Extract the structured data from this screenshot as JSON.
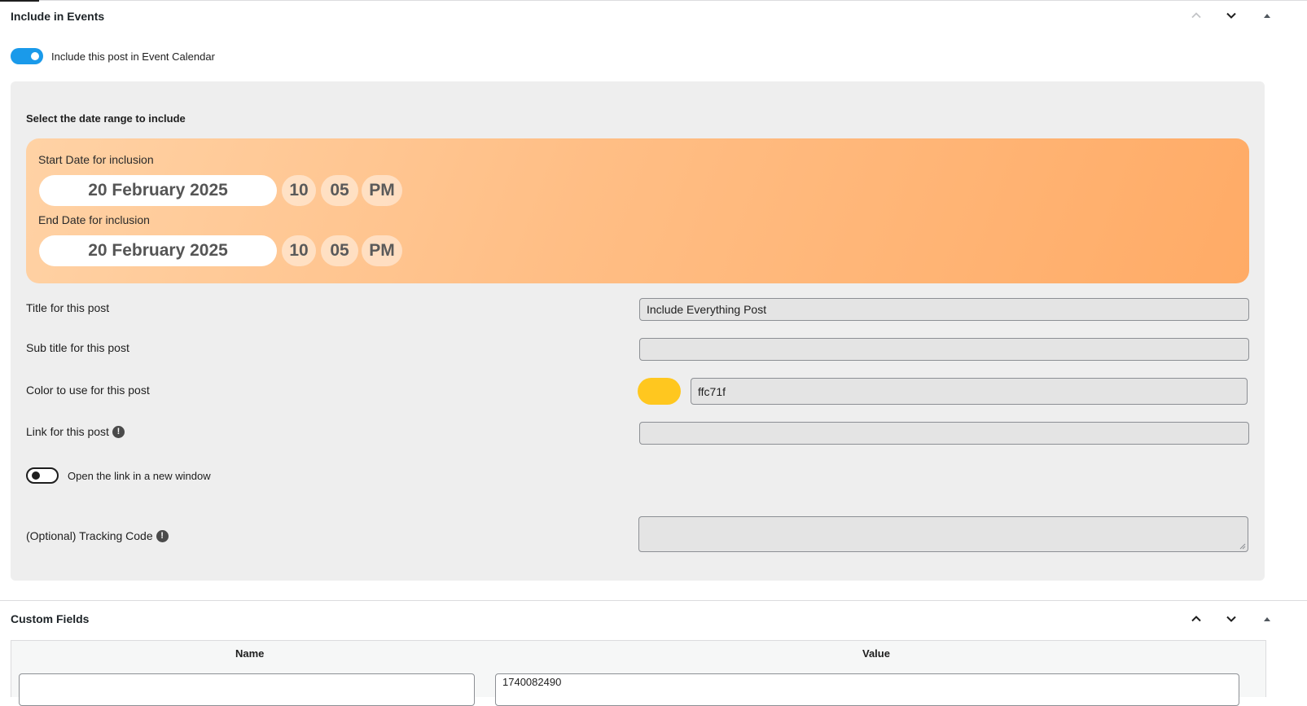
{
  "include_panel": {
    "title": "Include in Events",
    "move_up_label": "Move up",
    "move_down_label": "Move down",
    "toggle_panel_label": "Toggle panel",
    "include_toggle": {
      "label": "Include this post in Event Calendar",
      "checked": true
    },
    "date_range_heading": "Select the date range to include",
    "start": {
      "label": "Start Date for inclusion",
      "date": "20 February 2025",
      "hour": "10",
      "minute": "05",
      "ampm": "PM"
    },
    "end": {
      "label": "End Date for inclusion",
      "date": "20 February 2025",
      "hour": "10",
      "minute": "05",
      "ampm": "PM"
    },
    "title_field": {
      "label": "Title for this post",
      "value": "Include Everything Post"
    },
    "subtitle_field": {
      "label": "Sub title for this post",
      "value": ""
    },
    "color_field": {
      "label": "Color to use for this post",
      "value": "ffc71f",
      "swatch": "#ffc71f"
    },
    "link_field": {
      "label": "Link for this post",
      "value": ""
    },
    "new_window_toggle": {
      "label": "Open the link in a new window",
      "checked": false
    },
    "tracking_field": {
      "label": "(Optional) Tracking Code",
      "value": ""
    }
  },
  "custom_fields_panel": {
    "title": "Custom Fields",
    "columns": [
      "Name",
      "Value"
    ],
    "row_value_partial": "1740082490"
  },
  "colors": {
    "accent": "#1a9aea",
    "orange_start": "#ffd2a5",
    "orange_end": "#ffab66"
  }
}
